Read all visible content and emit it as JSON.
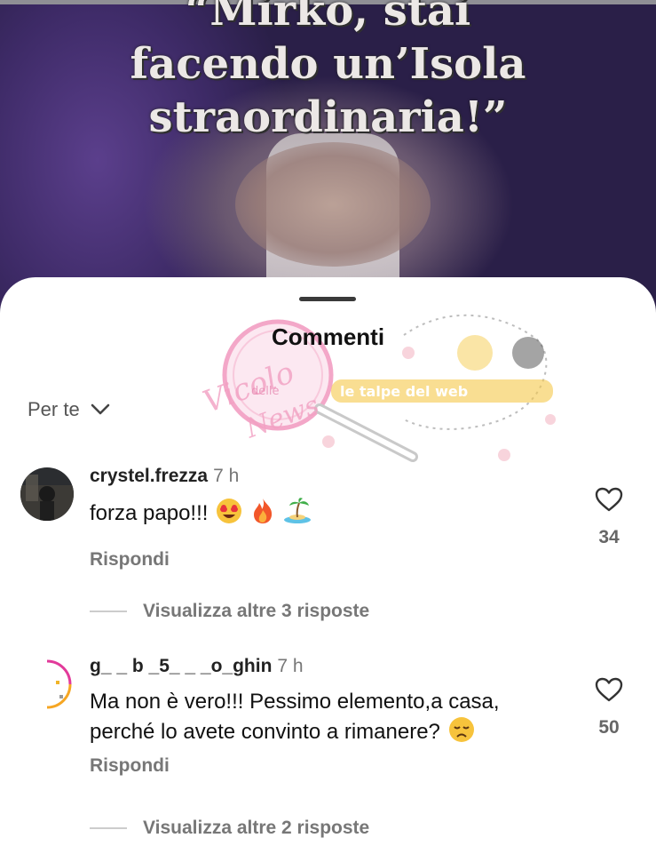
{
  "video": {
    "caption_lines": [
      "“Mirko, stai",
      "facendo un’Isola",
      "straordinaria!”"
    ]
  },
  "sheet": {
    "title": "Commenti",
    "sort_label": "Per te",
    "watermark": {
      "left_text": "Vicolo delle News",
      "right_text": "le talpe del web"
    }
  },
  "comments": [
    {
      "username": "crystel.frezza",
      "time": "7 h",
      "text": "forza papo!!!",
      "emojis": [
        "heart-eyes",
        "fire",
        "island"
      ],
      "reply_label": "Rispondi",
      "likes": "34",
      "more_replies": "Visualizza altre 3 risposte"
    },
    {
      "username": "g_  _ b  _5_  _  _o_ghin",
      "time": "7 h",
      "text": "Ma non è vero!!! Pessimo elemento,a casa, perché lo avete convinto a rimanere?",
      "emojis": [
        "disappointed"
      ],
      "reply_label": "Rispondi",
      "likes": "50",
      "more_replies": "Visualizza altre 2 risposte"
    }
  ],
  "colors": {
    "accent_text": "#111111",
    "muted_text": "#777777",
    "sheet_bg": "#ffffff"
  },
  "icons": [
    "heart-icon",
    "chevron-down-icon"
  ]
}
